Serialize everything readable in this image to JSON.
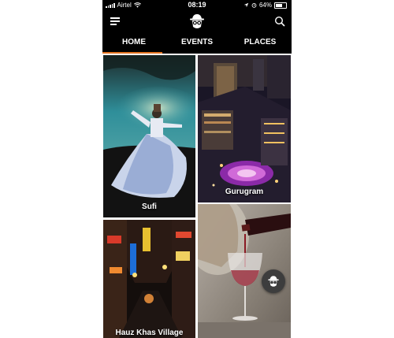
{
  "status_bar": {
    "carrier": "Airtel",
    "time": "08:19",
    "battery": "64%"
  },
  "header": {
    "logo": "detective-hat-glasses-logo",
    "menu_icon": "hamburger-icon",
    "search_icon": "search-icon"
  },
  "tabs": [
    {
      "label": "HOME",
      "active": true
    },
    {
      "label": "EVENTS",
      "active": false
    },
    {
      "label": "PLACES",
      "active": false
    }
  ],
  "tiles": [
    {
      "caption": "Sufi"
    },
    {
      "caption": "Gurugram"
    },
    {
      "caption": "Hauz Khas Village"
    },
    {
      "caption": ""
    }
  ],
  "colors": {
    "bar_background": "#000000",
    "active_tab_underline": "#e0711f",
    "fab_background": "#3d3d3d"
  }
}
